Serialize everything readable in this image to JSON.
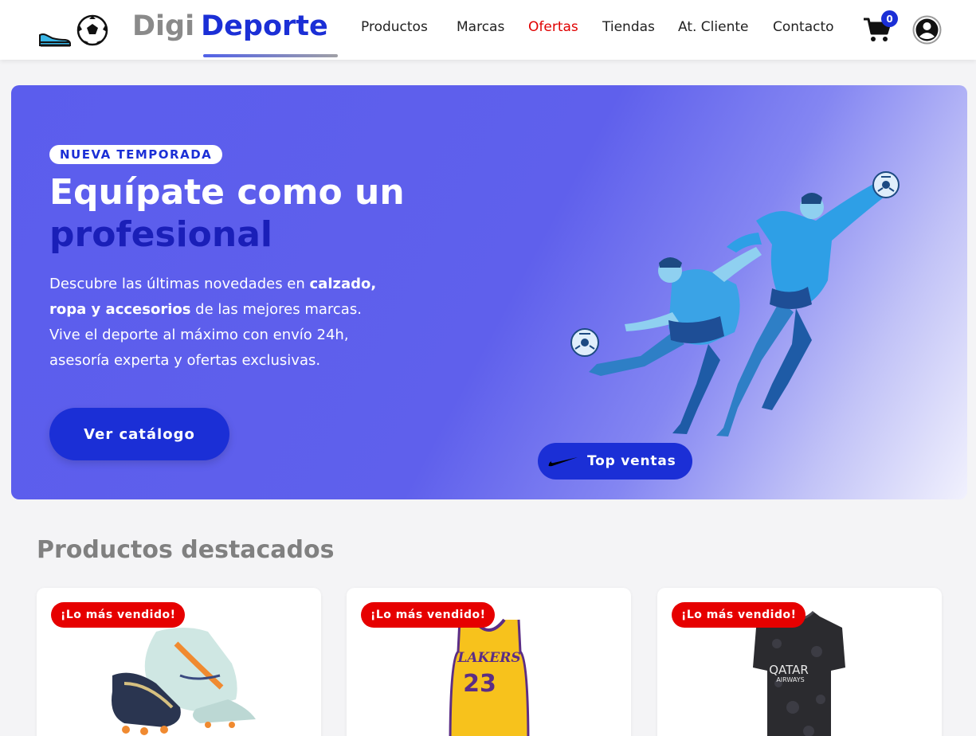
{
  "brand": {
    "part1": "Digi",
    "part2": "Deporte"
  },
  "nav": [
    {
      "label": "Productos",
      "highlight": false
    },
    {
      "label": "Marcas",
      "highlight": false
    },
    {
      "label": "Ofertas",
      "highlight": true
    },
    {
      "label": "Tiendas",
      "highlight": false
    },
    {
      "label": "At. Cliente",
      "highlight": false
    },
    {
      "label": "Contacto",
      "highlight": false
    }
  ],
  "cart": {
    "count": "0",
    "icon": "cart-icon"
  },
  "account": {
    "icon": "user-account-icon"
  },
  "hero": {
    "badge": "NUEVA TEMPORADA",
    "title_line1": "Equípate como un",
    "title_line2": "profesional",
    "desc": {
      "p1": "Descubre las últimas novedades en ",
      "b1": "calzado,",
      "b2": "ropa y accesorios",
      "p2": " de las mejores marcas.",
      "p3": "Vive el deporte al máximo con envío 24h,",
      "p4": "asesoría experta y ofertas exclusivas."
    },
    "cta": "Ver catálogo",
    "top_badge": "Top ventas"
  },
  "featured": {
    "title": "Productos destacados",
    "products": [
      {
        "badge": "¡Lo más vendido!",
        "image": "football-boots"
      },
      {
        "badge": "¡Lo más vendido!",
        "image": "lakers-jersey",
        "jersey_text": "LAKERS",
        "jersey_number": "23"
      },
      {
        "badge": "¡Lo más vendido!",
        "image": "psg-jersey",
        "jersey_text": "QATAR",
        "jersey_sub": "AIRWAYS"
      }
    ]
  },
  "colors": {
    "primary": "#1b2fd6",
    "offer": "#e00000",
    "badge": "#e60000",
    "hero": "#5f60ec"
  }
}
